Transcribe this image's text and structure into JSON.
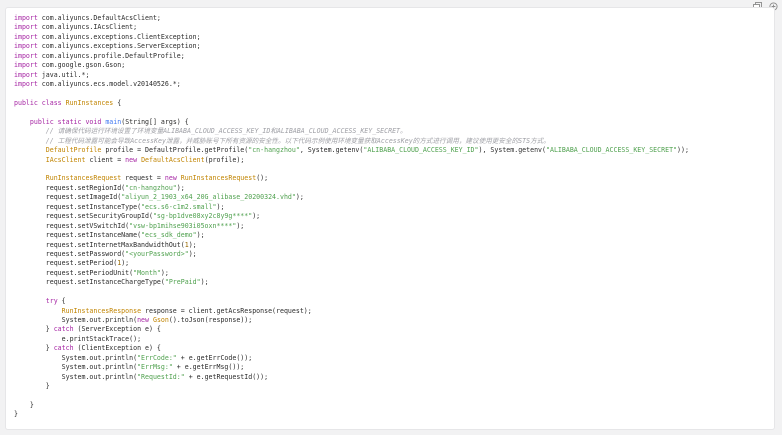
{
  "toolbar": {
    "copy_icon": "copy-icon",
    "expand_icon": "expand-icon"
  },
  "code": {
    "language": "java",
    "lines": [
      [
        {
          "t": "import",
          "c": "kw"
        },
        {
          "t": " com.aliyuncs.DefaultAcsClient;"
        }
      ],
      [
        {
          "t": "import",
          "c": "kw"
        },
        {
          "t": " com.aliyuncs.IAcsClient;"
        }
      ],
      [
        {
          "t": "import",
          "c": "kw"
        },
        {
          "t": " com.aliyuncs.exceptions.ClientException;"
        }
      ],
      [
        {
          "t": "import",
          "c": "kw"
        },
        {
          "t": " com.aliyuncs.exceptions.ServerException;"
        }
      ],
      [
        {
          "t": "import",
          "c": "kw"
        },
        {
          "t": " com.aliyuncs.profile.DefaultProfile;"
        }
      ],
      [
        {
          "t": "import",
          "c": "kw"
        },
        {
          "t": " com.google.gson.Gson;"
        }
      ],
      [
        {
          "t": "import",
          "c": "kw"
        },
        {
          "t": " java.util.*;"
        }
      ],
      [
        {
          "t": "import",
          "c": "kw"
        },
        {
          "t": " com.aliyuncs.ecs.model.v20140526.*;"
        }
      ],
      [],
      [
        {
          "t": "public class ",
          "c": "kw"
        },
        {
          "t": "RunInstances",
          "c": "cls"
        },
        {
          "t": " {"
        }
      ],
      [],
      [
        {
          "t": "    "
        },
        {
          "t": "public static void ",
          "c": "kw"
        },
        {
          "t": "main",
          "c": "fn"
        },
        {
          "t": "(String[] args) {"
        }
      ],
      [
        {
          "t": "        "
        },
        {
          "t": "// 请确保代码运行环境设置了环境变量ALIBABA_CLOUD_ACCESS_KEY_ID和ALIBABA_CLOUD_ACCESS_KEY_SECRET。",
          "c": "cmt"
        }
      ],
      [
        {
          "t": "        "
        },
        {
          "t": "// 工程代码泄露可能会导致AccessKey泄露，并威胁账号下所有资源的安全性。以下代码示例使用环境变量获取AccessKey的方式进行调用，建议使用更安全的STS方式。",
          "c": "cmt"
        }
      ],
      [
        {
          "t": "        "
        },
        {
          "t": "DefaultProfile",
          "c": "cls"
        },
        {
          "t": " profile = DefaultProfile.getProfile("
        },
        {
          "t": "\"cn-hangzhou\"",
          "c": "str"
        },
        {
          "t": ", System.getenv("
        },
        {
          "t": "\"ALIBABA_CLOUD_ACCESS_KEY_ID\"",
          "c": "str"
        },
        {
          "t": "), System.getenv("
        },
        {
          "t": "\"ALIBABA_CLOUD_ACCESS_KEY_SECRET\"",
          "c": "str"
        },
        {
          "t": "));"
        }
      ],
      [
        {
          "t": "        "
        },
        {
          "t": "IAcsClient",
          "c": "cls"
        },
        {
          "t": " client = "
        },
        {
          "t": "new ",
          "c": "kw"
        },
        {
          "t": "DefaultAcsClient",
          "c": "cls"
        },
        {
          "t": "(profile);"
        }
      ],
      [],
      [
        {
          "t": "        "
        },
        {
          "t": "RunInstancesRequest",
          "c": "cls"
        },
        {
          "t": " request = "
        },
        {
          "t": "new ",
          "c": "kw"
        },
        {
          "t": "RunInstancesRequest",
          "c": "cls"
        },
        {
          "t": "();"
        }
      ],
      [
        {
          "t": "        request.setRegionId("
        },
        {
          "t": "\"cn-hangzhou\"",
          "c": "str"
        },
        {
          "t": ");"
        }
      ],
      [
        {
          "t": "        request.setImageId("
        },
        {
          "t": "\"aliyun_2_1903_x64_20G_alibase_20200324.vhd\"",
          "c": "str"
        },
        {
          "t": ");"
        }
      ],
      [
        {
          "t": "        request.setInstanceType("
        },
        {
          "t": "\"ecs.s6-c1m2.small\"",
          "c": "str"
        },
        {
          "t": ");"
        }
      ],
      [
        {
          "t": "        request.setSecurityGroupId("
        },
        {
          "t": "\"sg-bp1dve08xy2c8y9g****\"",
          "c": "str"
        },
        {
          "t": ");"
        }
      ],
      [
        {
          "t": "        request.setVSwitchId("
        },
        {
          "t": "\"vsw-bp1mihse903i05oxn****\"",
          "c": "str"
        },
        {
          "t": ");"
        }
      ],
      [
        {
          "t": "        request.setInstanceName("
        },
        {
          "t": "\"ecs_sdk_demo\"",
          "c": "str"
        },
        {
          "t": ");"
        }
      ],
      [
        {
          "t": "        request.setInternetMaxBandwidthOut("
        },
        {
          "t": "1",
          "c": "num"
        },
        {
          "t": ");"
        }
      ],
      [
        {
          "t": "        request.setPassword("
        },
        {
          "t": "\"<yourPassword>\"",
          "c": "str"
        },
        {
          "t": ");"
        }
      ],
      [
        {
          "t": "        request.setPeriod("
        },
        {
          "t": "1",
          "c": "num"
        },
        {
          "t": ");"
        }
      ],
      [
        {
          "t": "        request.setPeriodUnit("
        },
        {
          "t": "\"Month\"",
          "c": "str"
        },
        {
          "t": ");"
        }
      ],
      [
        {
          "t": "        request.setInstanceChargeType("
        },
        {
          "t": "\"PrePaid\"",
          "c": "str"
        },
        {
          "t": ");"
        }
      ],
      [],
      [
        {
          "t": "        "
        },
        {
          "t": "try",
          "c": "kw"
        },
        {
          "t": " {"
        }
      ],
      [
        {
          "t": "            "
        },
        {
          "t": "RunInstancesResponse",
          "c": "cls"
        },
        {
          "t": " response = client.getAcsResponse(request);"
        }
      ],
      [
        {
          "t": "            System.out.println("
        },
        {
          "t": "new ",
          "c": "kw"
        },
        {
          "t": "Gson",
          "c": "cls"
        },
        {
          "t": "().toJson(response));"
        }
      ],
      [
        {
          "t": "        } "
        },
        {
          "t": "catch",
          "c": "kw"
        },
        {
          "t": " (ServerException e) {"
        }
      ],
      [
        {
          "t": "            e.printStackTrace();"
        }
      ],
      [
        {
          "t": "        } "
        },
        {
          "t": "catch",
          "c": "kw"
        },
        {
          "t": " (ClientException e) {"
        }
      ],
      [
        {
          "t": "            System.out.println("
        },
        {
          "t": "\"ErrCode:\"",
          "c": "str"
        },
        {
          "t": " + e.getErrCode());"
        }
      ],
      [
        {
          "t": "            System.out.println("
        },
        {
          "t": "\"ErrMsg:\"",
          "c": "str"
        },
        {
          "t": " + e.getErrMsg());"
        }
      ],
      [
        {
          "t": "            System.out.println("
        },
        {
          "t": "\"RequestId:\"",
          "c": "str"
        },
        {
          "t": " + e.getRequestId());"
        }
      ],
      [
        {
          "t": "        }"
        }
      ],
      [],
      [
        {
          "t": "    }"
        }
      ],
      [
        {
          "t": "}"
        }
      ]
    ]
  }
}
